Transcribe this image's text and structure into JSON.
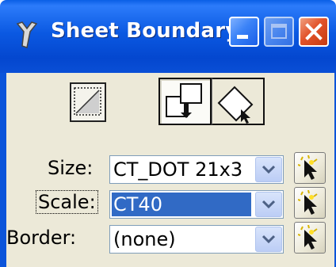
{
  "window": {
    "title": "Sheet Boundary",
    "controls": {
      "minimize": "minimize-icon",
      "maximize": "maximize-icon",
      "close": "close-icon"
    }
  },
  "toolbar": {
    "tools": [
      {
        "icon": "place-boundary-icon",
        "active": false
      },
      {
        "icon": "fit-to-shape-icon",
        "active": true
      },
      {
        "icon": "rotate-boundary-icon",
        "active": false
      }
    ]
  },
  "fields": {
    "size": {
      "label": "Size:",
      "value": "CT_DOT 21x3"
    },
    "scale": {
      "label": "Scale:",
      "value": "CT40"
    },
    "border": {
      "label": "Border:",
      "value": "(none)"
    }
  },
  "colors": {
    "selection": "#316ac5",
    "titlebar": "#0b59e2",
    "close": "#e2532a",
    "dialog": "#ece9d8"
  }
}
